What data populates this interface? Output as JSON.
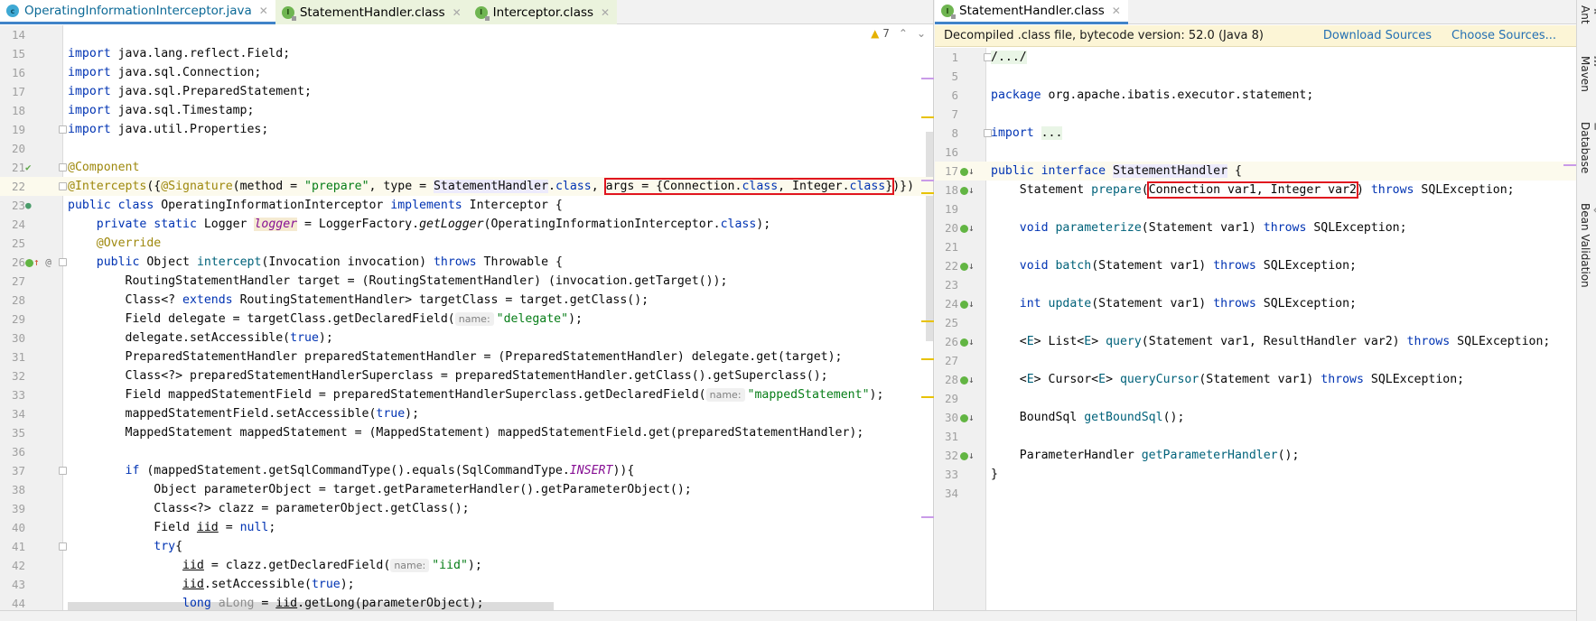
{
  "left_pane": {
    "tabs": [
      {
        "label": "OperatingInformationInterceptor.java",
        "icon": "class-c-icon",
        "active": true
      },
      {
        "label": "StatementHandler.class",
        "icon": "interface-i-icon",
        "active": false
      },
      {
        "label": "Interceptor.class",
        "icon": "interface-i-icon",
        "active": false
      }
    ],
    "warnings_count": "7",
    "lines": [
      {
        "n": "14",
        "html": ""
      },
      {
        "n": "15",
        "html": "<span class=\"kw\">import</span> java.lang.reflect.Field;"
      },
      {
        "n": "16",
        "html": "<span class=\"kw\">import</span> java.sql.Connection;"
      },
      {
        "n": "17",
        "html": "<span class=\"kw\">import</span> java.sql.PreparedStatement;"
      },
      {
        "n": "18",
        "html": "<span class=\"kw\">import</span> java.sql.Timestamp;"
      },
      {
        "n": "19",
        "html": "<span class=\"kw\">import</span> java.util.Properties;"
      },
      {
        "n": "20",
        "html": ""
      },
      {
        "n": "21",
        "html": "<span class=\"ann\">@Component</span>"
      },
      {
        "n": "22",
        "html": "<span class=\"ann\">@Intercepts</span>({<span class=\"ann\">@Signature</span>(method = <span class=\"str\">\"prepare\"</span>, type = <span class=\"cls-hl\">StatementHandler</span>.<span class=\"kw\">class</span>, <span class=\"redbox\">args = {Connection.<span class=\"kw\">class</span>, Integer.<span class=\"kw\">class</span>}</span>)})"
      },
      {
        "n": "23",
        "html": "<span class=\"kw\">public class</span> OperatingInformationInterceptor <span class=\"kw\">implements</span> Interceptor {"
      },
      {
        "n": "24",
        "html": "    <span class=\"kw\">private static</span> Logger <span class=\"fld field-hl\">logger</span> = LoggerFactory.<i>getLogger</i>(OperatingInformationInterceptor.<span class=\"kw\">class</span>);"
      },
      {
        "n": "25",
        "html": "    <span class=\"ann\">@Override</span>"
      },
      {
        "n": "26",
        "html": "    <span class=\"kw\">public</span> Object <span class=\"fn\">intercept</span>(Invocation invocation) <span class=\"kw\">throws</span> Throwable {"
      },
      {
        "n": "27",
        "html": "        RoutingStatementHandler target = (RoutingStatementHandler) (invocation.getTarget());"
      },
      {
        "n": "28",
        "html": "        Class&lt;? <span class=\"kw\">extends</span> RoutingStatementHandler&gt; targetClass = target.getClass();"
      },
      {
        "n": "29",
        "html": "        Field delegate = targetClass.getDeclaredField(<span class=\"hint\">name:</span><span class=\"str\">\"delegate\"</span>);"
      },
      {
        "n": "30",
        "html": "        delegate.setAccessible(<span class=\"kw\">true</span>);"
      },
      {
        "n": "31",
        "html": "        PreparedStatementHandler preparedStatementHandler = (PreparedStatementHandler) delegate.get(target);"
      },
      {
        "n": "32",
        "html": "        Class&lt;?&gt; preparedStatementHandlerSuperclass = preparedStatementHandler.getClass().getSuperclass();"
      },
      {
        "n": "33",
        "html": "        Field mappedStatementField = preparedStatementHandlerSuperclass.getDeclaredField(<span class=\"hint\">name:</span><span class=\"str\">\"mappedStatement\"</span>);"
      },
      {
        "n": "34",
        "html": "        mappedStatementField.setAccessible(<span class=\"kw\">true</span>);"
      },
      {
        "n": "35",
        "html": "        MappedStatement mappedStatement = (MappedStatement) mappedStatementField.get(preparedStatementHandler);"
      },
      {
        "n": "36",
        "html": ""
      },
      {
        "n": "37",
        "html": "        <span class=\"kw\">if</span> (mappedStatement.getSqlCommandType().equals(SqlCommandType.<span class=\"st\">INSERT</span>)){"
      },
      {
        "n": "38",
        "html": "            Object parameterObject = target.getParameterHandler().getParameterObject();"
      },
      {
        "n": "39",
        "html": "            Class&lt;?&gt; clazz = parameterObject.getClass();"
      },
      {
        "n": "40",
        "html": "            Field <span class=\"ul\">iid</span> = <span class=\"kw\">null</span>;"
      },
      {
        "n": "41",
        "html": "            <span class=\"kw\">try</span>{"
      },
      {
        "n": "42",
        "html": "                <span class=\"ul\">iid</span> = clazz.getDeclaredField(<span class=\"hint\">name:</span><span class=\"str\">\"iid\"</span>);"
      },
      {
        "n": "43",
        "html": "                <span class=\"ul\">iid</span>.setAccessible(<span class=\"kw\">true</span>);"
      },
      {
        "n": "44",
        "html": "                <span class=\"kw\">long</span> <span class=\"gray\">aLong</span> = <span class=\"ul\">iid</span>.getLong(parameterObject);"
      }
    ]
  },
  "right_pane": {
    "tab": {
      "label": "StatementHandler.class",
      "icon": "interface-i-icon"
    },
    "banner": {
      "message": "Decompiled .class file, bytecode version: 52.0 (Java 8)",
      "download_sources": "Download Sources",
      "choose_sources": "Choose Sources..."
    },
    "lines": [
      {
        "n": "1",
        "html": "<span class=\"fold-stub\">/.../</span>"
      },
      {
        "n": "5",
        "html": ""
      },
      {
        "n": "6",
        "html": "<span class=\"kw\">package</span> org.apache.ibatis.executor.statement;"
      },
      {
        "n": "7",
        "html": ""
      },
      {
        "n": "8",
        "html": "<span class=\"kw\">import</span> <span class=\"fold-stub\">...</span>"
      },
      {
        "n": "16",
        "html": ""
      },
      {
        "n": "17",
        "html": "<span class=\"kw\">public interface</span> <span class=\"cls-hl\">StatementHandler</span> {"
      },
      {
        "n": "18",
        "html": "    Statement <span class=\"fn\">prepare</span>(<span class=\"redbox\">Connection var1, Integer var2</span>) <span class=\"kw\">throws</span> SQLException;"
      },
      {
        "n": "19",
        "html": ""
      },
      {
        "n": "20",
        "html": "    <span class=\"kw\">void</span> <span class=\"fn\">parameterize</span>(Statement var1) <span class=\"kw\">throws</span> SQLException;"
      },
      {
        "n": "21",
        "html": ""
      },
      {
        "n": "22",
        "html": "    <span class=\"kw\">void</span> <span class=\"fn\">batch</span>(Statement var1) <span class=\"kw\">throws</span> SQLException;"
      },
      {
        "n": "23",
        "html": ""
      },
      {
        "n": "24",
        "html": "    <span class=\"kw\">int</span> <span class=\"fn\">update</span>(Statement var1) <span class=\"kw\">throws</span> SQLException;"
      },
      {
        "n": "25",
        "html": ""
      },
      {
        "n": "26",
        "html": "    &lt;<span class=\"fn\">E</span>&gt; List&lt;<span class=\"fn\">E</span>&gt; <span class=\"fn\">query</span>(Statement var1, ResultHandler var2) <span class=\"kw\">throws</span> SQLException;"
      },
      {
        "n": "27",
        "html": ""
      },
      {
        "n": "28",
        "html": "    &lt;<span class=\"fn\">E</span>&gt; Cursor&lt;<span class=\"fn\">E</span>&gt; <span class=\"fn\">queryCursor</span>(Statement var1) <span class=\"kw\">throws</span> SQLException;"
      },
      {
        "n": "29",
        "html": ""
      },
      {
        "n": "30",
        "html": "    BoundSql <span class=\"fn\">getBoundSql</span>();"
      },
      {
        "n": "31",
        "html": ""
      },
      {
        "n": "32",
        "html": "    ParameterHandler <span class=\"fn\">getParameterHandler</span>();"
      },
      {
        "n": "33",
        "html": "}"
      },
      {
        "n": "34",
        "html": ""
      }
    ]
  },
  "tool_strip": [
    {
      "label": "Ant",
      "icon": "ant-icon"
    },
    {
      "label": "Maven",
      "icon": "maven-icon"
    },
    {
      "label": "Database",
      "icon": "database-icon"
    },
    {
      "label": "Bean Validation",
      "icon": "bean-validation-icon"
    }
  ]
}
